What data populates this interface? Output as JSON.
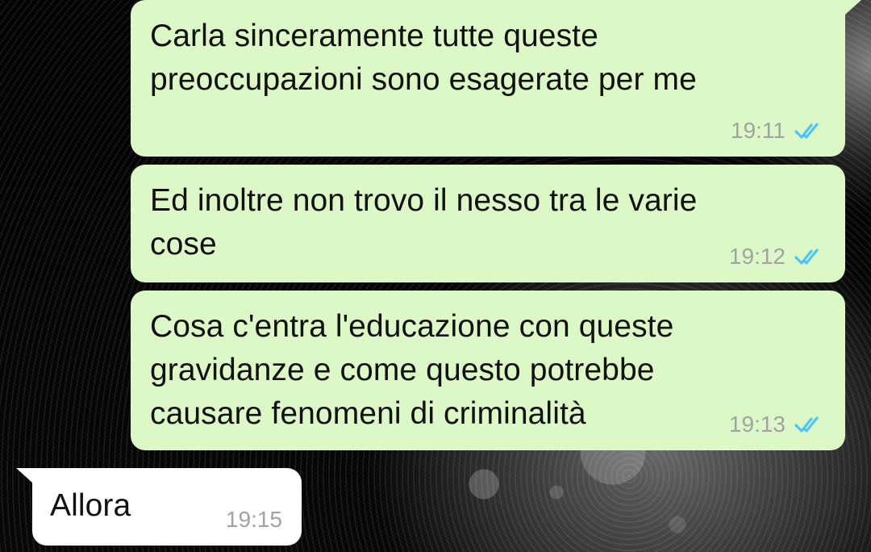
{
  "messages": [
    {
      "text": "Carla sinceramente tutte queste\npreoccupazioni sono esagerate per me",
      "time": "19:11",
      "status_icon": "double-check-read-icon"
    },
    {
      "text": "Ed inoltre non trovo il nesso tra le varie\ncose",
      "time": "19:12",
      "status_icon": "double-check-read-icon"
    },
    {
      "text": "Cosa c'entra l'educazione con queste\ngravidanze e come questo potrebbe\ncausare fenomeni di criminalità",
      "time": "19:13",
      "status_icon": "double-check-read-icon"
    },
    {
      "text": "Allora",
      "time": "19:15"
    }
  ],
  "colors": {
    "outgoing_bubble": "#dcf8c6",
    "incoming_bubble": "#ffffff",
    "timestamp": "#a2a2a2",
    "read_check": "#4fc3f7",
    "background": "#000000"
  }
}
